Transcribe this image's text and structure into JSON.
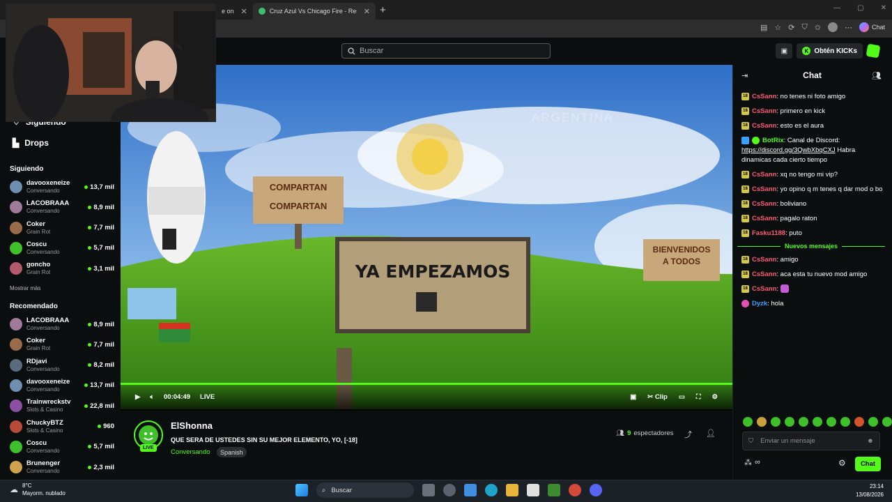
{
  "browser": {
    "tabs": [
      {
        "label": "e on",
        "close": "✕"
      },
      {
        "label": "Cruz Azul Vs Chicago Fire - Result",
        "close": "✕"
      }
    ],
    "new_tab": "+",
    "copilot_label": "Chat"
  },
  "header": {
    "search_placeholder": "Buscar",
    "kicks_label": "Obtén KICKs",
    "accent": "#53fc18"
  },
  "sidebar": {
    "following_top": "Siguiendo",
    "drops": "Drops",
    "following_title": "Siguiendo",
    "following": [
      {
        "name": "davooxeneize",
        "category": "Conversando",
        "viewers": "13,7 mil",
        "color": "#6f8fb0"
      },
      {
        "name": "LACOBRAAA",
        "category": "Conversando",
        "viewers": "8,9 mil",
        "color": "#a07a9a"
      },
      {
        "name": "Coker",
        "category": "Grain Rot",
        "viewers": "7,7 mil",
        "color": "#9a6b4b"
      },
      {
        "name": "Coscu",
        "category": "Conversando",
        "viewers": "5,7 mil",
        "color": "#3fbf2a"
      },
      {
        "name": "goncho",
        "category": "Grain Rot",
        "viewers": "3,1 mil",
        "color": "#b35b6d"
      }
    ],
    "show_more": "Mostrar más",
    "recommended_title": "Recomendado",
    "recommended": [
      {
        "name": "LACOBRAAA",
        "category": "Conversando",
        "viewers": "8,9 mil",
        "color": "#a07a9a"
      },
      {
        "name": "Coker",
        "category": "Grain Rot",
        "viewers": "7,7 mil",
        "color": "#9a6b4b"
      },
      {
        "name": "RDjavi",
        "category": "Conversando",
        "viewers": "8,2 mil",
        "color": "#5a6b7d"
      },
      {
        "name": "davooxeneize",
        "category": "Conversando",
        "viewers": "13,7 mil",
        "color": "#6f8fb0"
      },
      {
        "name": "Trainwreckstv",
        "category": "Slots & Casino",
        "viewers": "22,8 mil",
        "color": "#8b4fa3"
      },
      {
        "name": "ChuckyBTZ",
        "category": "Slots & Casino",
        "viewers": "960",
        "color": "#b84a3a"
      },
      {
        "name": "Coscu",
        "category": "Conversando",
        "viewers": "5,7 mil",
        "color": "#3fbf2a"
      },
      {
        "name": "Brunenger",
        "category": "Conversando",
        "viewers": "2,3 mil",
        "color": "#d0a24a"
      }
    ]
  },
  "video": {
    "sign_main": "YA EMPEZAMOS",
    "sign_left_1": "COMPARTAN",
    "sign_left_2": "COMPARTAN",
    "sign_right_1": "BIENVENIDOS",
    "sign_right_2": "A TODOS",
    "sky_text": "ARGENTINA",
    "time": "00:04:49",
    "live": "LIVE",
    "clip": "Clip"
  },
  "stream": {
    "streamer": "ElShonna",
    "live_badge": "LIVE",
    "title": "QUE SERA DE USTEDES SIN SU MEJOR ELEMENTO, YO, [-18]",
    "category": "Conversando",
    "language": "Spanish",
    "viewer_count": "9",
    "viewer_label": "espectadores"
  },
  "chat": {
    "title": "Chat",
    "messages": [
      {
        "badge": "18",
        "user": "CsSann",
        "color": "#ff5a72",
        "text": "no tenes ni foto amigo"
      },
      {
        "badge": "18",
        "user": "CsSann",
        "color": "#ff5a72",
        "text": "primero en kick"
      },
      {
        "badge": "18",
        "user": "CsSann",
        "color": "#ff5a72",
        "text": "esto es el aura"
      },
      {
        "badge": "bot",
        "user": "BotRix",
        "color": "#53fc18",
        "text": "Canal de Discord:",
        "link": "https://discord.gg/3QwbXbqCXJ",
        "text2": "Habra dinamicas cada cierto tiempo"
      },
      {
        "badge": "18",
        "user": "CsSann",
        "color": "#ff5a72",
        "text": "xq no tengo mi vip?"
      },
      {
        "badge": "18",
        "user": "CsSann",
        "color": "#ff5a72",
        "text": "yo opino q m tenes q dar mod o bo"
      },
      {
        "badge": "18",
        "user": "CsSann",
        "color": "#ff5a72",
        "text": "boliviano"
      },
      {
        "badge": "18",
        "user": "CsSann",
        "color": "#ff5a72",
        "text": "pagalo raton"
      },
      {
        "badge": "18",
        "user": "Fasku1188",
        "color": "#ff5a72",
        "text": "puto"
      }
    ],
    "new_messages": "Nuevos mensajes",
    "messages_after": [
      {
        "badge": "18",
        "user": "CsSann",
        "color": "#ff5a72",
        "text": "amigo"
      },
      {
        "badge": "18",
        "user": "CsSann",
        "color": "#ff5a72",
        "text": "aca esta tu nuevo mod amigo"
      },
      {
        "badge": "18",
        "user": "CsSann",
        "color": "#ff5a72",
        "text": ""
      },
      {
        "badge": "dyzk",
        "user": "Dyzk",
        "color": "#3aa0ff",
        "text": "hola"
      }
    ],
    "input_placeholder": "Enviar un mensaje",
    "send_label": "Chat"
  },
  "taskbar": {
    "temp": "8°C",
    "weather": "Mayorm. nublado",
    "search": "Buscar",
    "time": "23:14",
    "date": "13/08/2026"
  }
}
